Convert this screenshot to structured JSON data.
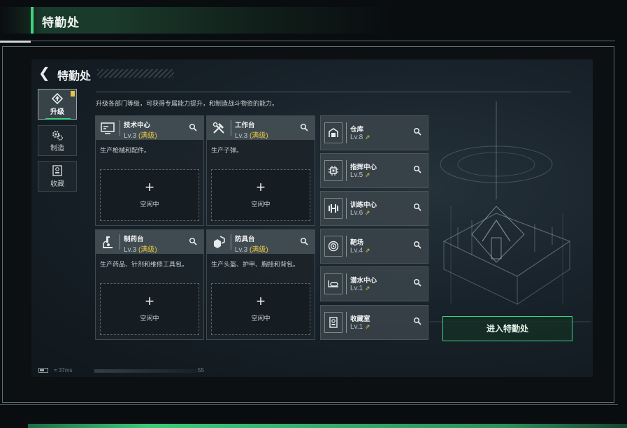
{
  "header": {
    "title": "特勤处"
  },
  "screen": {
    "title": "特勤处",
    "description": "升级各部门等级，可获得专属能力提升，和制造战斗物资的能力。",
    "enter_button": "进入特勤处"
  },
  "tabs": [
    {
      "label": "升级",
      "icon": "upgrade-icon",
      "active": true
    },
    {
      "label": "制造",
      "icon": "gears-icon",
      "active": false
    },
    {
      "label": "收藏",
      "icon": "collection-icon",
      "active": false
    }
  ],
  "workshops": [
    {
      "name": "技术中心",
      "level": "Lv.3",
      "status": "(满级)",
      "desc": "生产枪械和配件。",
      "slot_label": "空闲中",
      "icon": "monitor-icon"
    },
    {
      "name": "工作台",
      "level": "Lv.3",
      "status": "(满级)",
      "desc": "生产子弹。",
      "slot_label": "空闲中",
      "icon": "tools-icon"
    },
    {
      "name": "制药台",
      "level": "Lv.3",
      "status": "(满级)",
      "desc": "生产药品、针剂和维修工具包。",
      "slot_label": "空闲中",
      "icon": "microscope-icon"
    },
    {
      "name": "防具台",
      "level": "Lv.3",
      "status": "(满级)",
      "desc": "生产头盔、护甲、胸挂和背包。",
      "slot_label": "空闲中",
      "icon": "armor-icon"
    }
  ],
  "facilities": [
    {
      "name": "仓库",
      "level": "Lv.8",
      "icon": "warehouse-icon"
    },
    {
      "name": "指挥中心",
      "level": "Lv.5",
      "icon": "chip-icon"
    },
    {
      "name": "训练中心",
      "level": "Lv.6",
      "icon": "dumbbell-icon"
    },
    {
      "name": "靶场",
      "level": "Lv.4",
      "icon": "target-icon"
    },
    {
      "name": "潜水中心",
      "level": "Lv.1",
      "icon": "diving-icon"
    },
    {
      "name": "收藏室",
      "level": "Lv.1",
      "icon": "collection-room-icon"
    }
  ],
  "status_bar": {
    "ping": "37ms",
    "number": "55"
  },
  "colors": {
    "accent": "#3fd47e",
    "level_gold": "#e8c545"
  }
}
